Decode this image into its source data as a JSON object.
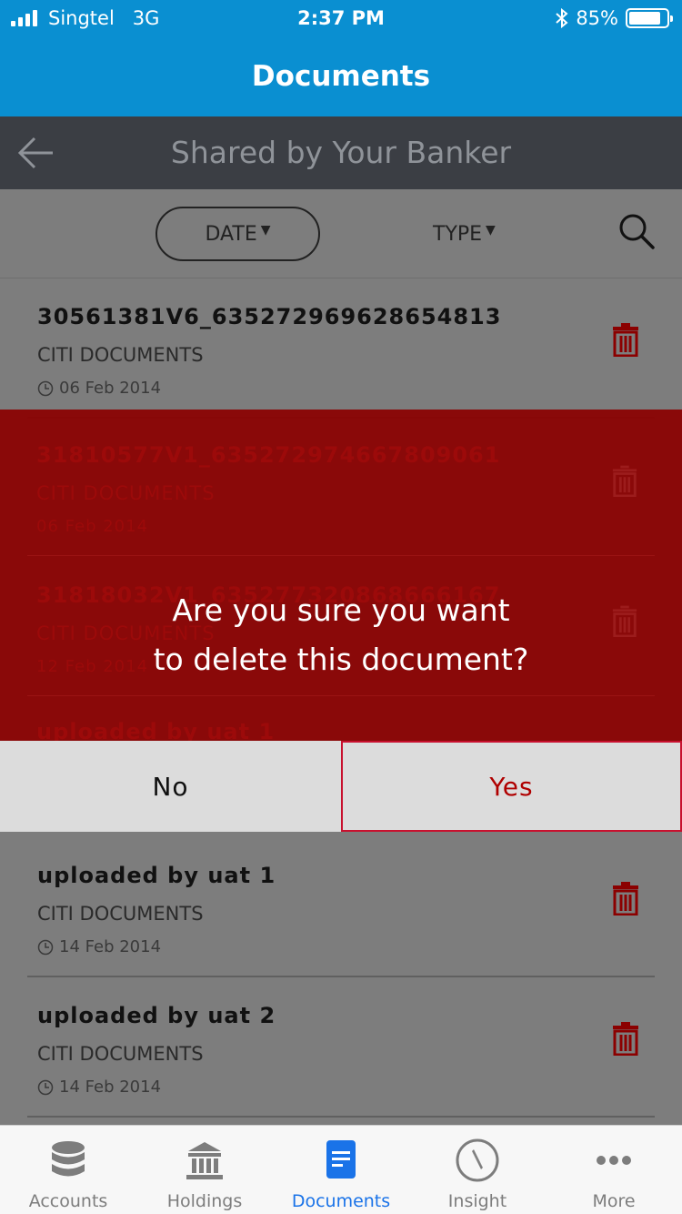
{
  "status_bar": {
    "carrier": "Singtel",
    "network": "3G",
    "time": "2:37 PM",
    "bluetooth_icon": "bluetooth-icon",
    "battery_percent": "85%",
    "battery_level": 0.85
  },
  "header": {
    "title": "Documents"
  },
  "sub_header": {
    "title": "Shared by Your Banker",
    "back_icon": "back-arrow-icon"
  },
  "filters": {
    "date_label": "DATE",
    "type_label": "TYPE",
    "caret": "▼",
    "search_icon": "search-icon"
  },
  "documents": [
    {
      "name": "30561381V6_635272969628654813",
      "category": "CITI DOCUMENTS",
      "date": "06 Feb 2014"
    },
    {
      "name": "31810577V1_635272974667809061",
      "category": "CITI DOCUMENTS",
      "date": "06 Feb 2014"
    },
    {
      "name": "31818032V1_635277320868666167",
      "category": "CITI DOCUMENTS",
      "date": "12 Feb 2014"
    },
    {
      "name": "uploaded by uat 1",
      "category": "CITI DOCUMENTS",
      "date": "14 Feb 2014"
    },
    {
      "name": "uploaded by uat 2",
      "category": "CITI DOCUMENTS",
      "date": "14 Feb 2014"
    }
  ],
  "dialog": {
    "message_line1": "Are you sure you want",
    "message_line2": "to delete this document?",
    "no_label": "No",
    "yes_label": "Yes"
  },
  "tabs": [
    {
      "label": "Accounts",
      "icon": "database-icon",
      "active": false
    },
    {
      "label": "Holdings",
      "icon": "bank-building-icon",
      "active": false
    },
    {
      "label": "Documents",
      "icon": "document-icon",
      "active": true
    },
    {
      "label": "Insight",
      "icon": "compass-icon",
      "active": false
    },
    {
      "label": "More",
      "icon": "more-dots-icon",
      "active": false
    }
  ],
  "colors": {
    "brand_blue": "#0a8fd1",
    "dialog_red": "#8b0000",
    "delete_red": "#b00000",
    "active_tab": "#1a73e8"
  }
}
